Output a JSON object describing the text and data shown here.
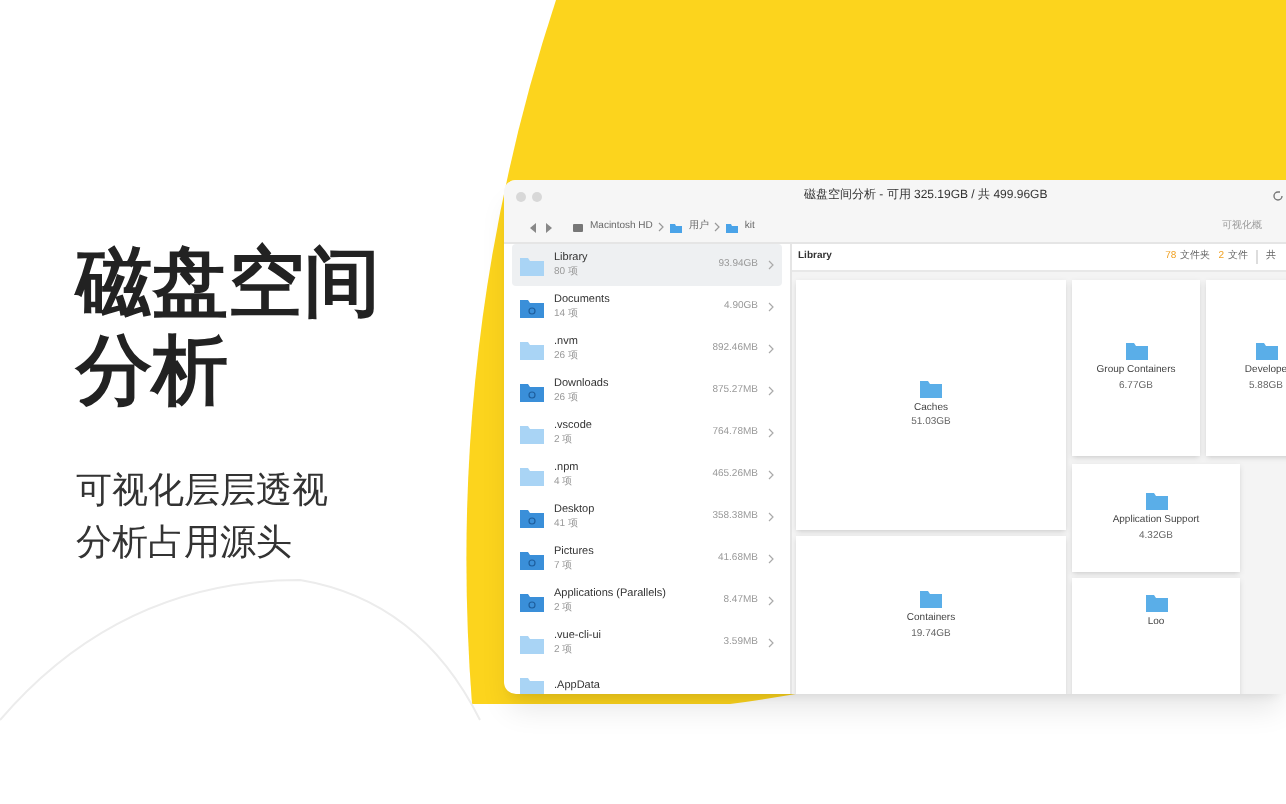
{
  "headline_lines": [
    "磁盘空间",
    "分析"
  ],
  "subtitle_lines": [
    "可视化层层透视",
    "分析占用源头"
  ],
  "window": {
    "title": "磁盘空间分析 - 可用 325.19GB / 共 499.96GB",
    "breadcrumb": [
      "Macintosh HD",
      "用户",
      "kit"
    ],
    "toolbar_right": "可视化概"
  },
  "sidebar": {
    "items": [
      {
        "name": "Library",
        "count": "80 项",
        "size": "93.94GB",
        "selected": true,
        "kind": "plain"
      },
      {
        "name": "Documents",
        "count": "14 项",
        "size": "4.90GB",
        "selected": false,
        "kind": "system"
      },
      {
        "name": ".nvm",
        "count": "26 项",
        "size": "892.46MB",
        "selected": false,
        "kind": "plain"
      },
      {
        "name": "Downloads",
        "count": "26 项",
        "size": "875.27MB",
        "selected": false,
        "kind": "system"
      },
      {
        "name": ".vscode",
        "count": "2 项",
        "size": "764.78MB",
        "selected": false,
        "kind": "plain"
      },
      {
        "name": ".npm",
        "count": "4 项",
        "size": "465.26MB",
        "selected": false,
        "kind": "plain"
      },
      {
        "name": "Desktop",
        "count": "41 项",
        "size": "358.38MB",
        "selected": false,
        "kind": "system"
      },
      {
        "name": "Pictures",
        "count": "7 项",
        "size": "41.68MB",
        "selected": false,
        "kind": "system"
      },
      {
        "name": "Applications (Parallels)",
        "count": "2 项",
        "size": "8.47MB",
        "selected": false,
        "kind": "system"
      },
      {
        "name": ".vue-cli-ui",
        "count": "2 项",
        "size": "3.59MB",
        "selected": false,
        "kind": "plain"
      },
      {
        "name": ".AppData",
        "selected": false,
        "kind": "plain"
      }
    ]
  },
  "content": {
    "title": "Library",
    "folders_count": "78",
    "folders_label": "文件夹",
    "files_count": "2",
    "files_label": "文件",
    "total_label": "共",
    "tiles": [
      {
        "name": "Caches",
        "size": "51.03GB"
      },
      {
        "name": "Containers",
        "size": "19.74GB"
      },
      {
        "name": "Group Containers",
        "size": "6.77GB"
      },
      {
        "name": "Develope",
        "size": "5.88GB"
      },
      {
        "name": "Application Support",
        "size": "4.32GB"
      },
      {
        "name": "Loo"
      }
    ]
  }
}
